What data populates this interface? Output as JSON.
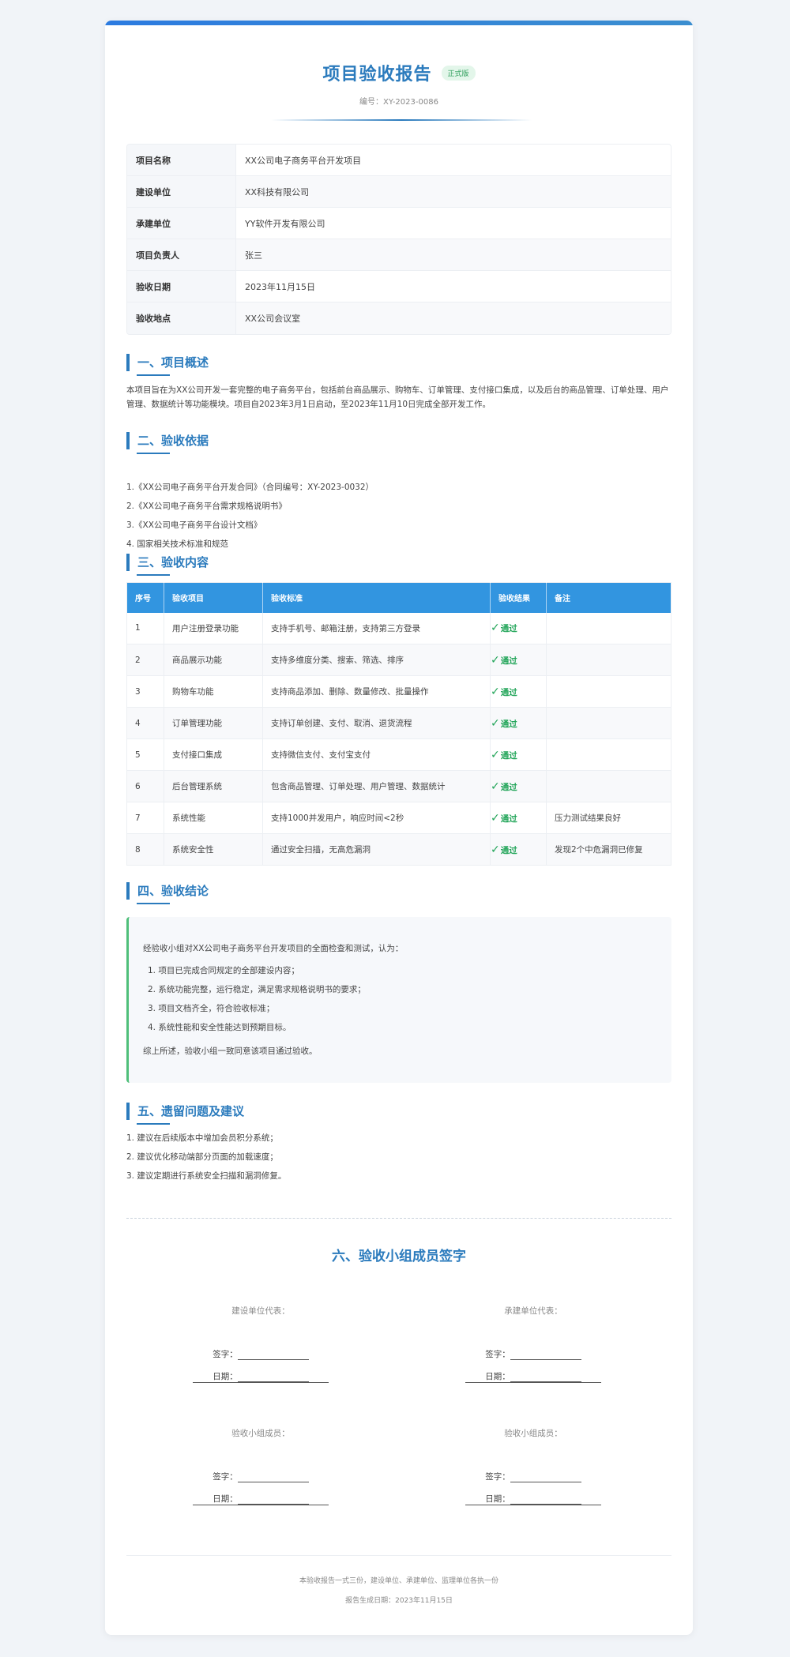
{
  "header": {
    "title": "项目验收报告",
    "badge": "正式版",
    "doc_no": "编号：XY-2023-0086"
  },
  "info": [
    {
      "label": "项目名称",
      "value": "XX公司电子商务平台开发项目"
    },
    {
      "label": "建设单位",
      "value": "XX科技有限公司"
    },
    {
      "label": "承建单位",
      "value": "YY软件开发有限公司"
    },
    {
      "label": "项目负责人",
      "value": "张三"
    },
    {
      "label": "验收日期",
      "value": "2023年11月15日"
    },
    {
      "label": "验收地点",
      "value": "XX公司会议室"
    }
  ],
  "section1": {
    "title": "一、项目概述",
    "text": "本项目旨在为XX公司开发一套完整的电子商务平台，包括前台商品展示、购物车、订单管理、支付接口集成，以及后台的商品管理、订单处理、用户管理、数据统计等功能模块。项目自2023年3月1日启动，至2023年11月10日完成全部开发工作。"
  },
  "section2": {
    "title": "二、验收依据",
    "items": [
      "1.《XX公司电子商务平台开发合同》（合同编号：XY-2023-0032）",
      "2.《XX公司电子商务平台需求规格说明书》",
      "3.《XX公司电子商务平台设计文档》",
      "4. 国家相关技术标准和规范"
    ]
  },
  "section3": {
    "title": "三、验收内容",
    "headers": [
      "序号",
      "验收项目",
      "验收标准",
      "验收结果",
      "备注"
    ],
    "check_icon": "✓",
    "rows": [
      {
        "no": "1",
        "item": "用户注册登录功能",
        "standard": "支持手机号、邮箱注册，支持第三方登录",
        "result": "通过",
        "note": ""
      },
      {
        "no": "2",
        "item": "商品展示功能",
        "standard": "支持多维度分类、搜索、筛选、排序",
        "result": "通过",
        "note": ""
      },
      {
        "no": "3",
        "item": "购物车功能",
        "standard": "支持商品添加、删除、数量修改、批量操作",
        "result": "通过",
        "note": ""
      },
      {
        "no": "4",
        "item": "订单管理功能",
        "standard": "支持订单创建、支付、取消、退货流程",
        "result": "通过",
        "note": ""
      },
      {
        "no": "5",
        "item": "支付接口集成",
        "standard": "支持微信支付、支付宝支付",
        "result": "通过",
        "note": ""
      },
      {
        "no": "6",
        "item": "后台管理系统",
        "standard": "包含商品管理、订单处理、用户管理、数据统计",
        "result": "通过",
        "note": ""
      },
      {
        "no": "7",
        "item": "系统性能",
        "standard": "支持1000并发用户，响应时间<2秒",
        "result": "通过",
        "note": "压力测试结果良好"
      },
      {
        "no": "8",
        "item": "系统安全性",
        "standard": "通过安全扫描，无高危漏洞",
        "result": "通过",
        "note": "发现2个中危漏洞已修复"
      }
    ]
  },
  "section4": {
    "title": "四、验收结论",
    "intro": "经验收小组对XX公司电子商务平台开发项目的全面检查和测试，认为：",
    "items": [
      "1. 项目已完成合同规定的全部建设内容；",
      "2. 系统功能完整，运行稳定，满足需求规格说明书的要求；",
      "3. 项目文档齐全，符合验收标准；",
      "4. 系统性能和安全性能达到预期目标。"
    ],
    "summary": "综上所述，验收小组一致同意该项目通过验收。"
  },
  "section5": {
    "title": "五、遗留问题及建议",
    "items": [
      "1. 建议在后续版本中增加会员积分系统；",
      "2. 建议优化移动端部分页面的加载速度；",
      "3. 建议定期进行系统安全扫描和漏洞修复。"
    ]
  },
  "section6": {
    "title": "六、验收小组成员签字",
    "sign_label": "签字：",
    "date_label": "日期：",
    "blocks": [
      {
        "role": "建设单位代表："
      },
      {
        "role": "承建单位代表："
      },
      {
        "role": "验收小组成员："
      },
      {
        "role": "验收小组成员："
      }
    ]
  },
  "footer": {
    "note": "本验收报告一式三份，建设单位、承建单位、监理单位各执一份",
    "date": "报告生成日期：2023年11月15日"
  },
  "colors": {
    "accent": "#2b7bbd",
    "table_header": "#3295e0",
    "pass": "#22a559",
    "conclusion_border": "#4fbf7a"
  }
}
